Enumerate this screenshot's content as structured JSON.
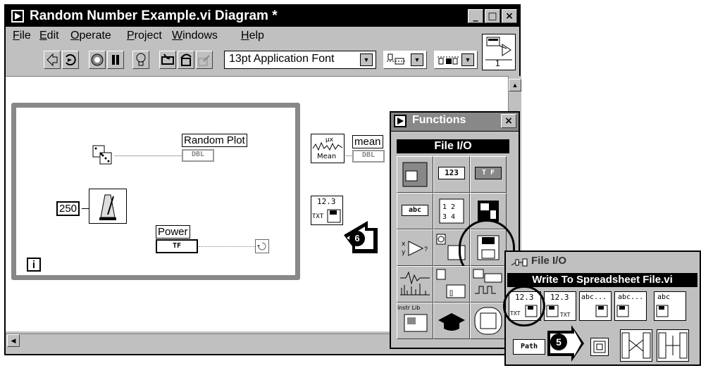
{
  "window": {
    "title": "Random Number Example.vi Diagram *",
    "controls": [
      "_",
      "□",
      "×"
    ]
  },
  "menu": [
    "File",
    "Edit",
    "Operate",
    "Project",
    "Windows",
    "Help"
  ],
  "toolbar": {
    "font_select": "13pt Application Font",
    "icons": [
      "run-arrow-icon",
      "run-continuously-icon",
      "abort-icon",
      "pause-icon",
      "highlight-execution-icon",
      "step-into-icon",
      "step-over-icon",
      "step-out-icon"
    ],
    "connector_pane_number": "1"
  },
  "diagram": {
    "random_plot_label": "Random Plot",
    "random_plot_type": "DBL",
    "mean_label": "mean",
    "mean_type": "DBL",
    "mean_vi_label": "Mean",
    "constant_250": "250",
    "power_label": "Power",
    "power_type": "TF",
    "loop_index": "i",
    "spreadsheet_icon_value": "12.3",
    "spreadsheet_icon_txt": "TXT",
    "callout_6": "6"
  },
  "functions_palette": {
    "title": "Functions",
    "header": "File I/O",
    "cells": [
      [
        "cell-boolean-numeric",
        "123",
        "T F"
      ],
      [
        "abc",
        "cluster-array",
        "file-io"
      ],
      [
        "comparison",
        "time-dialog",
        "file-io-selected"
      ],
      [
        "analyze",
        "communication",
        "instrument-io"
      ],
      [
        "Instr Lib",
        "tutorial",
        "select-vi"
      ]
    ],
    "cell_labels": {
      "numeric": "123",
      "boolean": "T F",
      "string": "abc",
      "instr_lib": "Instr Lib"
    }
  },
  "file_io_subpalette": {
    "title": "File I/O",
    "selected_label": "Write To Spreadsheet File.vi",
    "icons_row1": [
      "12.3 TXT",
      "12.3 TXT",
      "abc...",
      "abc...",
      "abc"
    ],
    "icon_texts": {
      "write_value": "12.3",
      "write_txt": "TXT",
      "read_value": "12.3",
      "read_txt": "TXT",
      "abc1": "abc...",
      "abc2": "abc...",
      "abc3": "abc"
    },
    "path_label": "Path",
    "callout_5": "5"
  }
}
